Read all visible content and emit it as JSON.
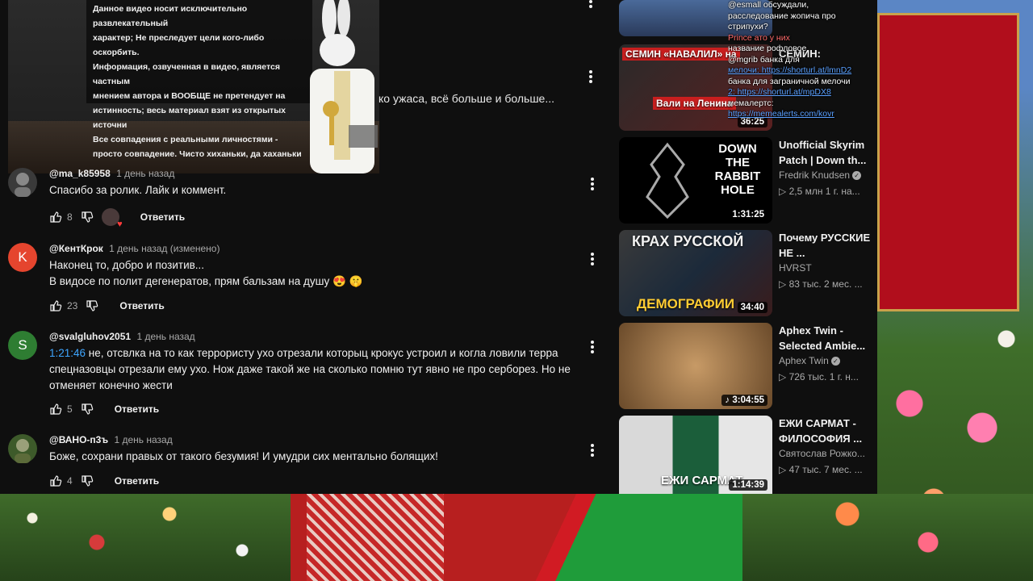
{
  "video": {
    "disclaimer": [
      "Данное видео носит исключительно развлекательный",
      "характер; Не преследует цели кого-либо оскорбить.",
      "Информация, озвученная в видео, является частным",
      "мнением автора и ВООБЩЕ не претендует на",
      "истинность; весь материал взят из открытых источни",
      "Все совпадения с реальными личностями -",
      "просто совпадение. Чисто хиханьки, да хаханьки"
    ],
    "overflow_snippet": "ко ужаса, всё больше и больше..."
  },
  "comments": [
    {
      "author": "@ma_k85958",
      "time": "1 день назад",
      "text": "Спасибо за ролик. Лайк и коммент.",
      "likes": "8",
      "reply": "Ответить",
      "avatar_letter": "",
      "avatar_color": "#3a3a3a"
    },
    {
      "author": "@КентКрок",
      "time": "1 день назад (изменено)",
      "text_lines": [
        "Наконец то, добро и позитив...",
        "В видосе по полит дегенератов, прям бальзам на душу 😍 🤫"
      ],
      "likes": "23",
      "reply": "Ответить",
      "avatar_letter": "K",
      "avatar_color": "#e5452e"
    },
    {
      "author": "@svalgluhov2051",
      "time": "1 день назад",
      "timestamp": "1:21:46",
      "text": " не, отсвлка на то как террористу ухо отрезали которыц крокус устроил и когла ловили терра спецназовцы  отрезали ему ухо. Нож даже такой же на сколько помню тут явно не про серборез. Но не отменяет конечно жести",
      "likes": "5",
      "reply": "Ответить",
      "avatar_letter": "S",
      "avatar_color": "#2e7d32"
    },
    {
      "author": "@ВАНО-п3ъ",
      "time": "1 день назад",
      "text": "Боже, сохрани правых от такого безумия! И умудри сих ментально болящих!",
      "likes": "4",
      "reply": "Ответить",
      "avatar_letter": "",
      "avatar_color": "#3d5a2a"
    }
  ],
  "related": [
    {
      "title": "СЕМИН:",
      "channel": "",
      "meta": "",
      "duration": "36:25",
      "thumb_text": "СЕМИН «НАВАЛИЛ» на",
      "thumb_caption": "Вали на Ленина"
    },
    {
      "title": "Unofficial Skyrim Patch | Down th...",
      "channel": "Fredrik Knudsen",
      "meta": "2,5 млн  1 г. на...",
      "duration": "1:31:25",
      "thumb_text": "DOWN THE RABBIT HOLE"
    },
    {
      "title": "Почему РУССКИЕ НЕ ...",
      "channel": "HVRST",
      "meta": "83 тыс.  2 мес. ...",
      "duration": "34:40",
      "thumb_text": "КРАХ РУССКОЙ",
      "thumb_caption": "ДЕМОГРАФИИ"
    },
    {
      "title": "Aphex Twin - Selected Ambie...",
      "channel": "Aphex Twin",
      "meta": "726 тыс.  1 г. н...",
      "duration": "3:04:55"
    },
    {
      "title": "ЕЖИ САРМАТ - ФИЛОСОФИЯ ...",
      "channel": "Святослав Рожко...",
      "meta": "47 тыс.  7 мес. ...",
      "duration": "1:14:39",
      "thumb_text": "ЕЖИ САРМАТ"
    }
  ],
  "chat": {
    "lines": [
      "@esmall    обсуждали,",
      "расследование жопича про",
      "стрипухи?",
      "Prince    ато у них",
      "название рофловое",
      "@mgrib    банка для",
      "мелочи: https://shorturl.at/lmnD2",
      "банка для заграничной мелочи",
      "2: https://shorturl.at/mpDX8",
      "мемалертс:",
      "https://memealerts.com/kovr"
    ]
  }
}
